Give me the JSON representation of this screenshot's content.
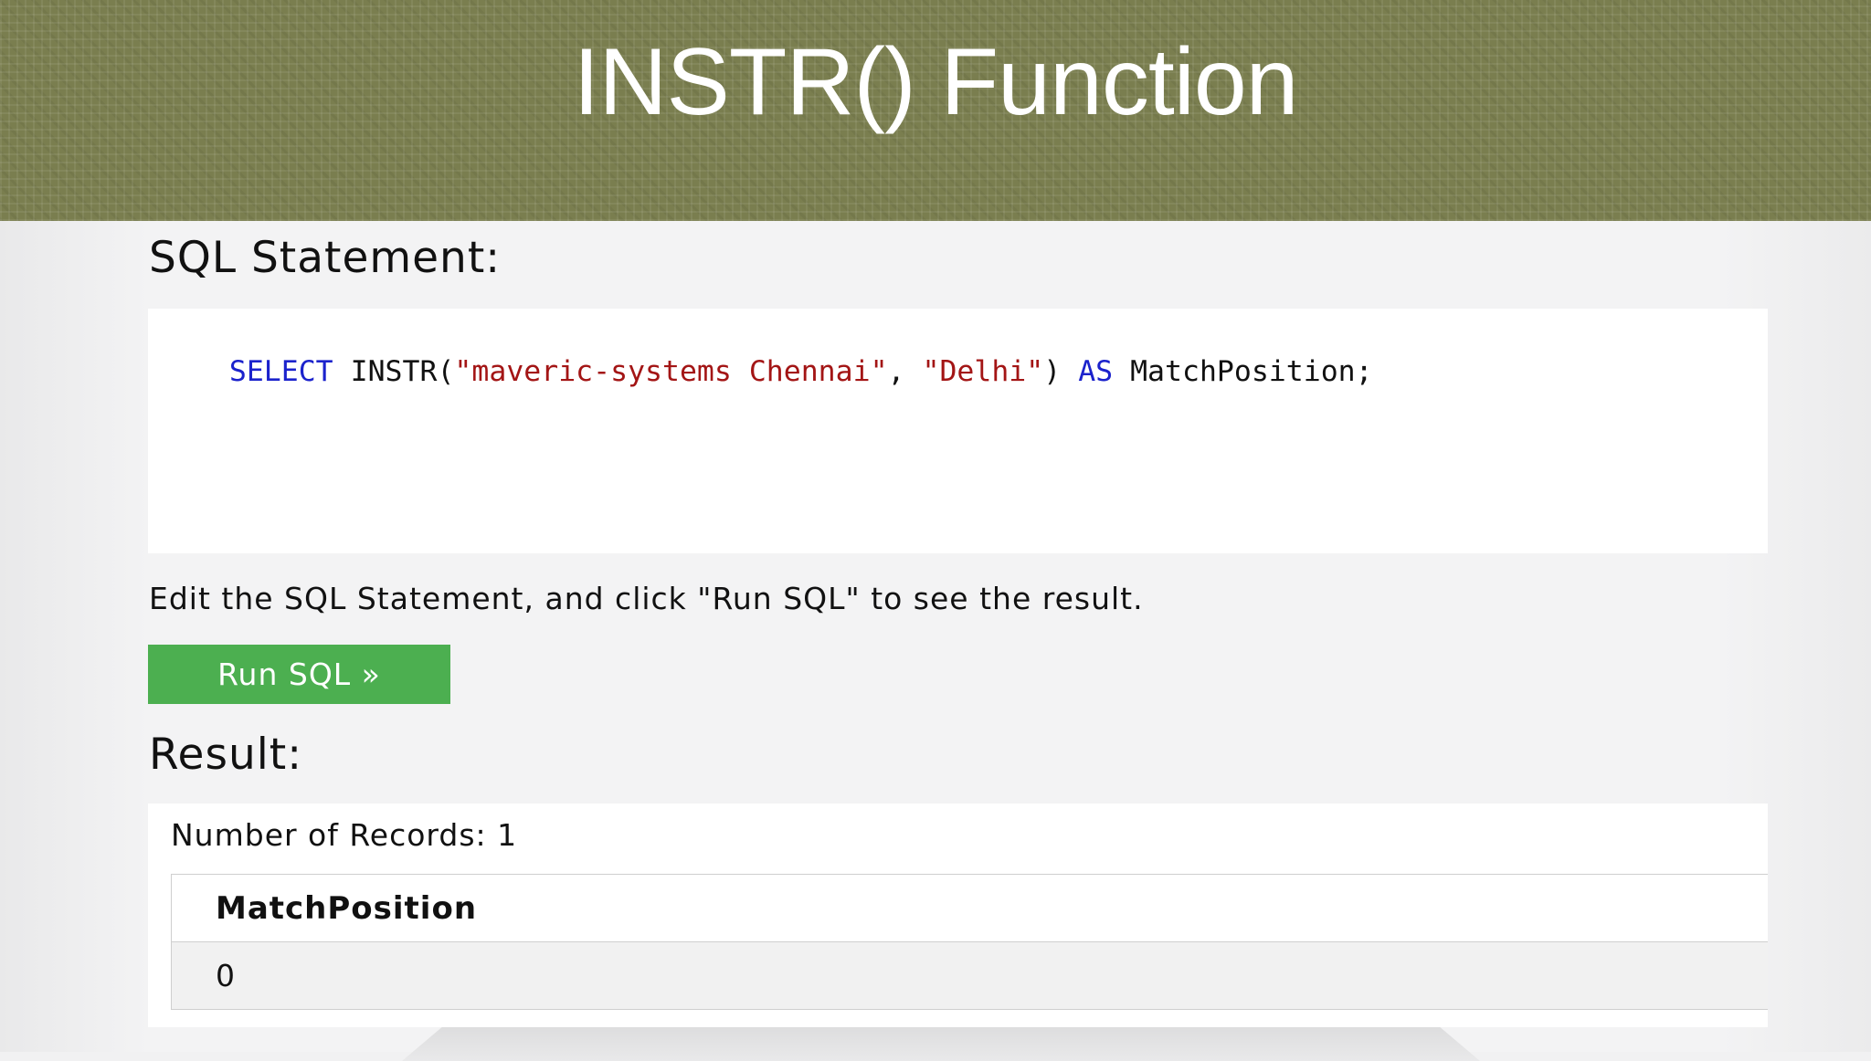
{
  "banner": {
    "title": "INSTR() Function"
  },
  "editor": {
    "heading": "SQL Statement:",
    "code_tokens": [
      {
        "type": "kw",
        "text": "SELECT"
      },
      {
        "type": "plain",
        "text": " INSTR("
      },
      {
        "type": "str",
        "text": "\"maveric-systems Chennai\""
      },
      {
        "type": "plain",
        "text": ", "
      },
      {
        "type": "str",
        "text": "\"Delhi\""
      },
      {
        "type": "plain",
        "text": ") "
      },
      {
        "type": "kw",
        "text": "AS"
      },
      {
        "type": "plain",
        "text": " MatchPosition;"
      }
    ],
    "hint": "Edit the SQL Statement, and click \"Run SQL\" to see the result.",
    "run_button_label": "Run SQL »"
  },
  "result": {
    "heading": "Result:",
    "records_text": "Number of Records: 1",
    "columns": [
      "MatchPosition"
    ],
    "rows": [
      [
        "0"
      ]
    ]
  },
  "colors": {
    "banner": "#7a7e4f",
    "keyword": "#1b22cc",
    "string": "#a31515",
    "button": "#4caf50"
  }
}
